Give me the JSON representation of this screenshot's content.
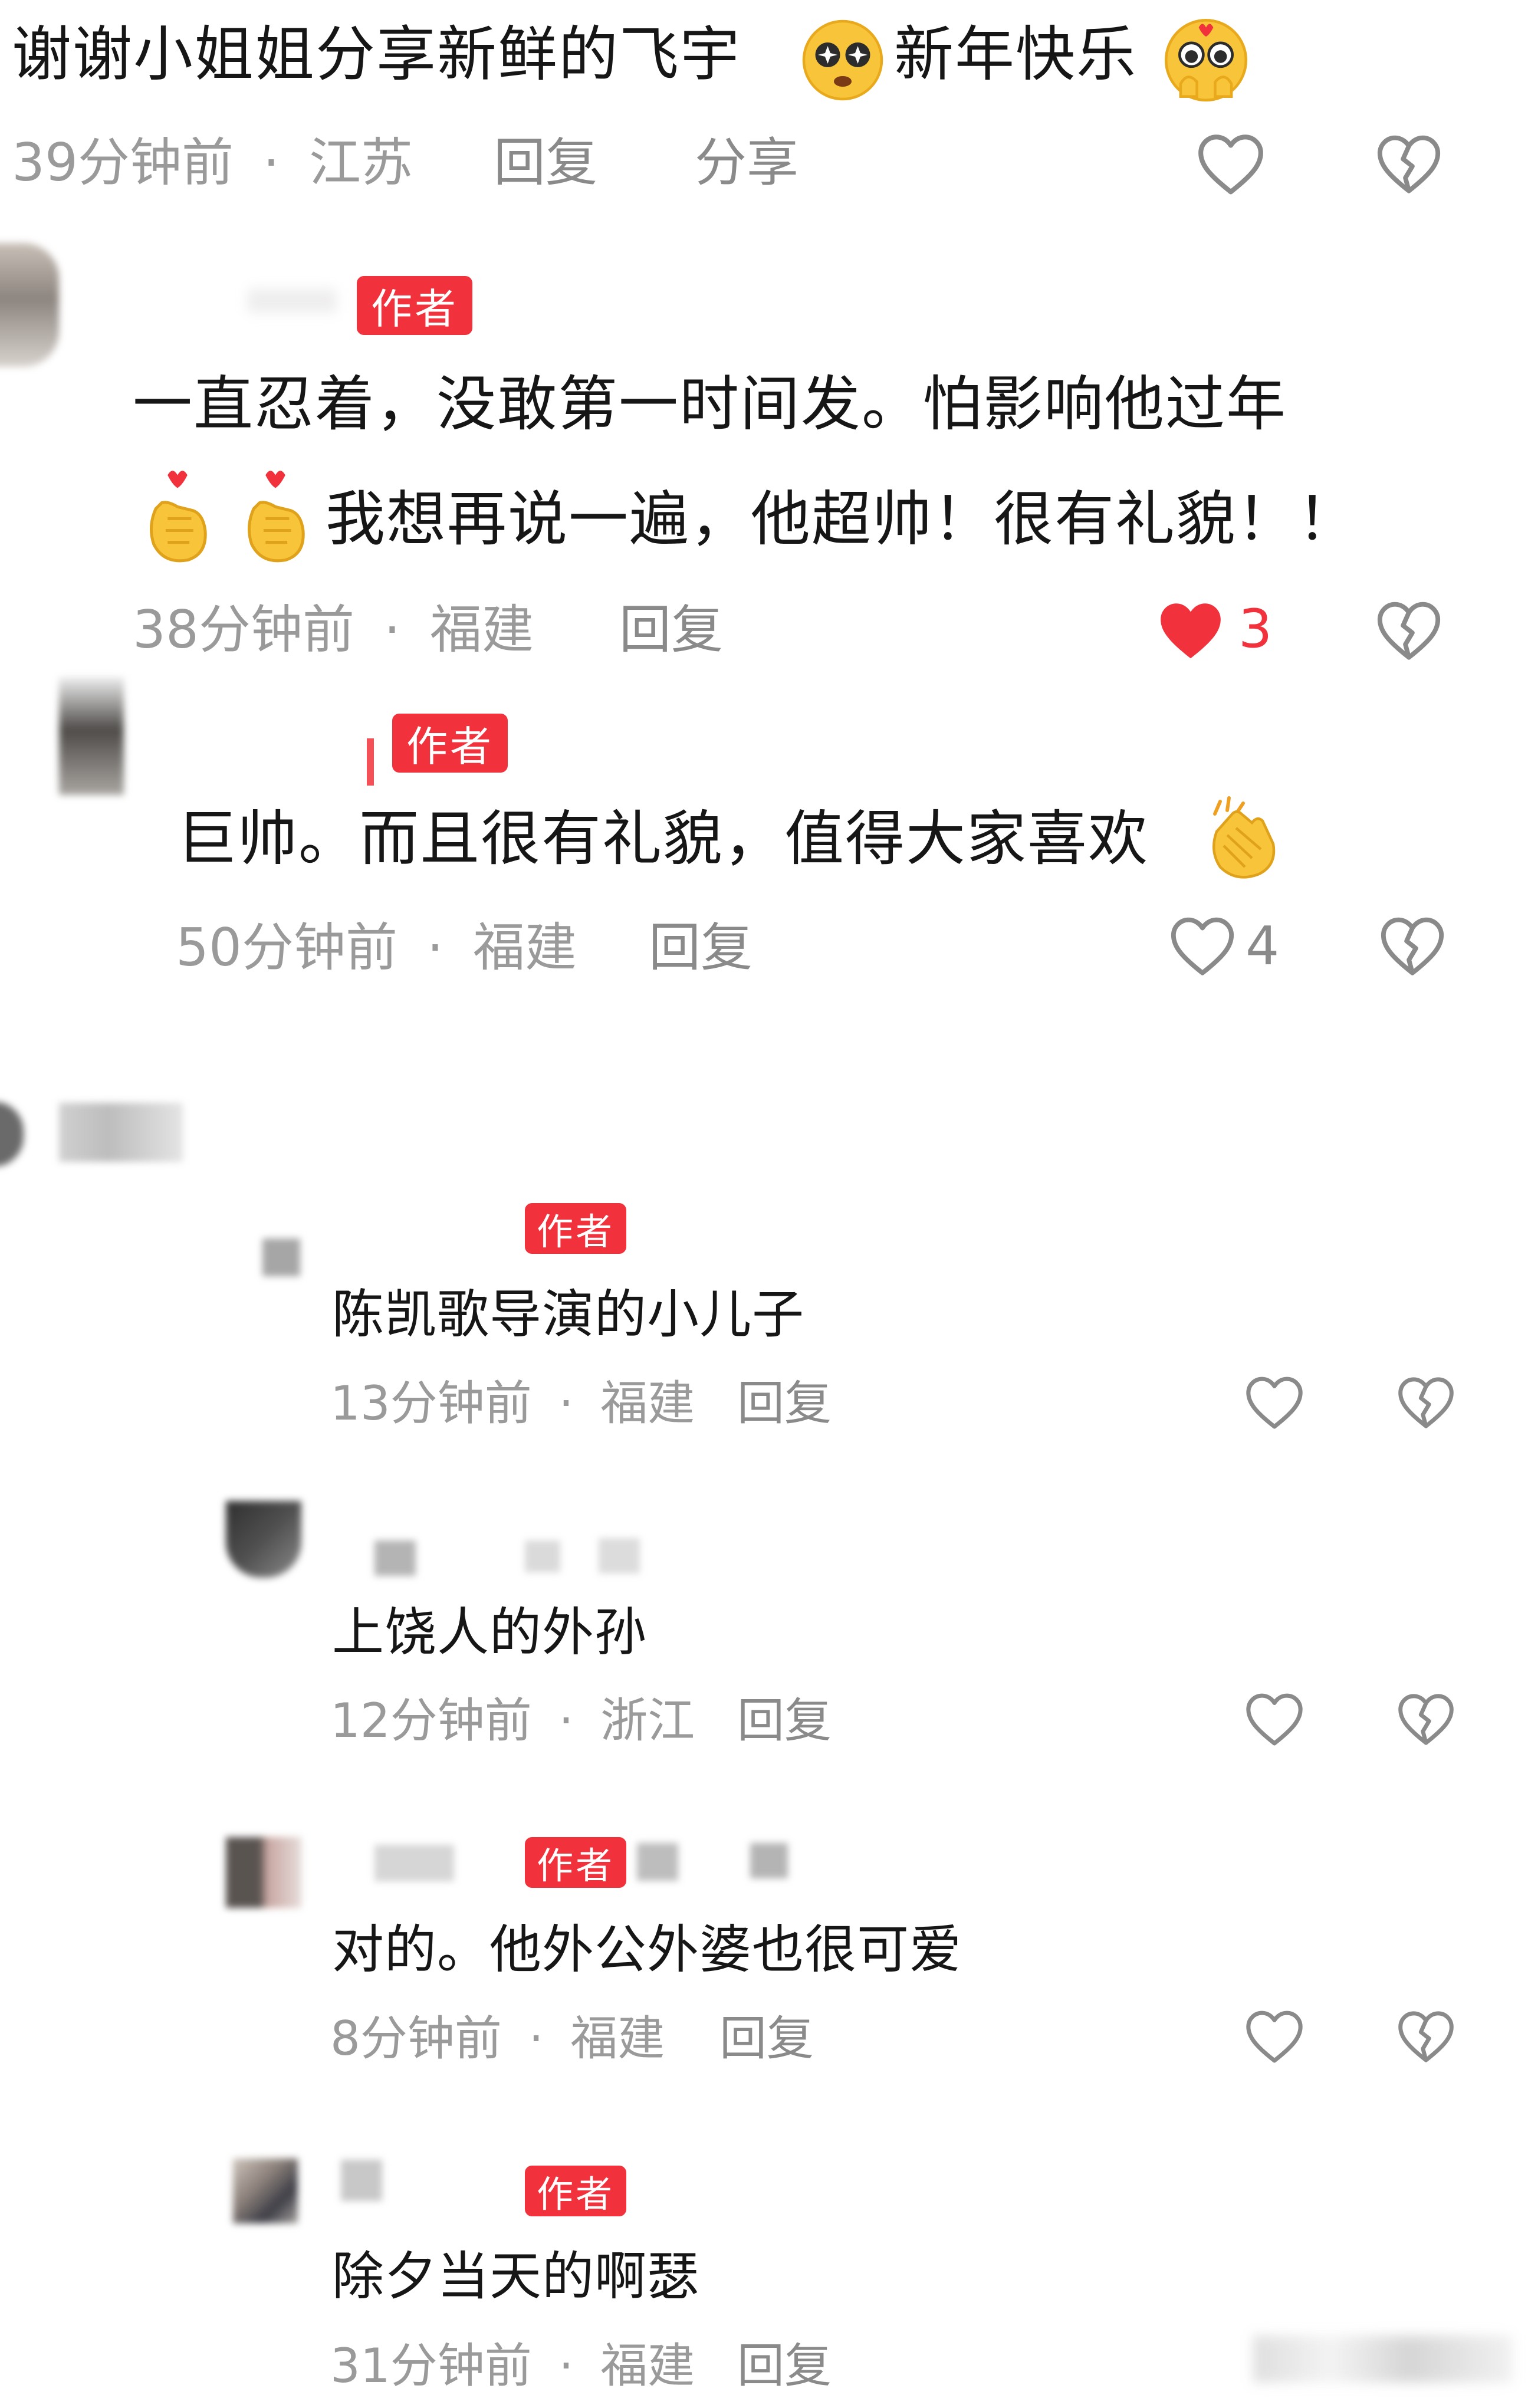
{
  "colors": {
    "badge": "#f1313b",
    "liked": "#f1313b",
    "meta": "#9a9a9a",
    "text": "#161616"
  },
  "author_badge": "作者",
  "comments": [
    {
      "text_a": "谢谢小姐姐分享新鲜的飞宇",
      "text_b": "新年快乐",
      "time": "39分钟前",
      "location": "江苏",
      "reply": "回复",
      "share": "分享",
      "emoji_icons": [
        "starry-eyed-face-icon",
        "pleading-face-icon"
      ]
    },
    {
      "line1": "一直忍着，没敢第一时间发。怕影响他过年",
      "line2": "我想再说一遍，他超帅！很有礼貌！！",
      "time": "38分钟前",
      "location": "福建",
      "reply": "回复",
      "likes": "3",
      "liked": true,
      "emoji_icons": [
        "heart-hands-icon",
        "heart-hands-icon"
      ]
    },
    {
      "text": "巨帅。而且很有礼貌，值得大家喜欢",
      "time": "50分钟前",
      "location": "福建",
      "reply": "回复",
      "likes": "4",
      "emoji_icons": [
        "clapping-hands-icon"
      ]
    }
  ],
  "replies": [
    {
      "text": "陈凯歌导演的小儿子",
      "time": "13分钟前",
      "location": "福建",
      "reply": "回复"
    },
    {
      "text": "上饶人的外孙",
      "time": "12分钟前",
      "location": "浙江",
      "reply": "回复"
    },
    {
      "text": "对的。他外公外婆也很可爱",
      "time": "8分钟前",
      "location": "福建",
      "reply": "回复"
    },
    {
      "text": "除夕当天的啊瑟",
      "time": "31分钟前",
      "location": "福建",
      "reply": "回复"
    }
  ],
  "separator": "·",
  "icons": {
    "like": "heart-outline-icon",
    "like_filled": "heart-filled-icon",
    "dislike": "broken-heart-icon"
  }
}
